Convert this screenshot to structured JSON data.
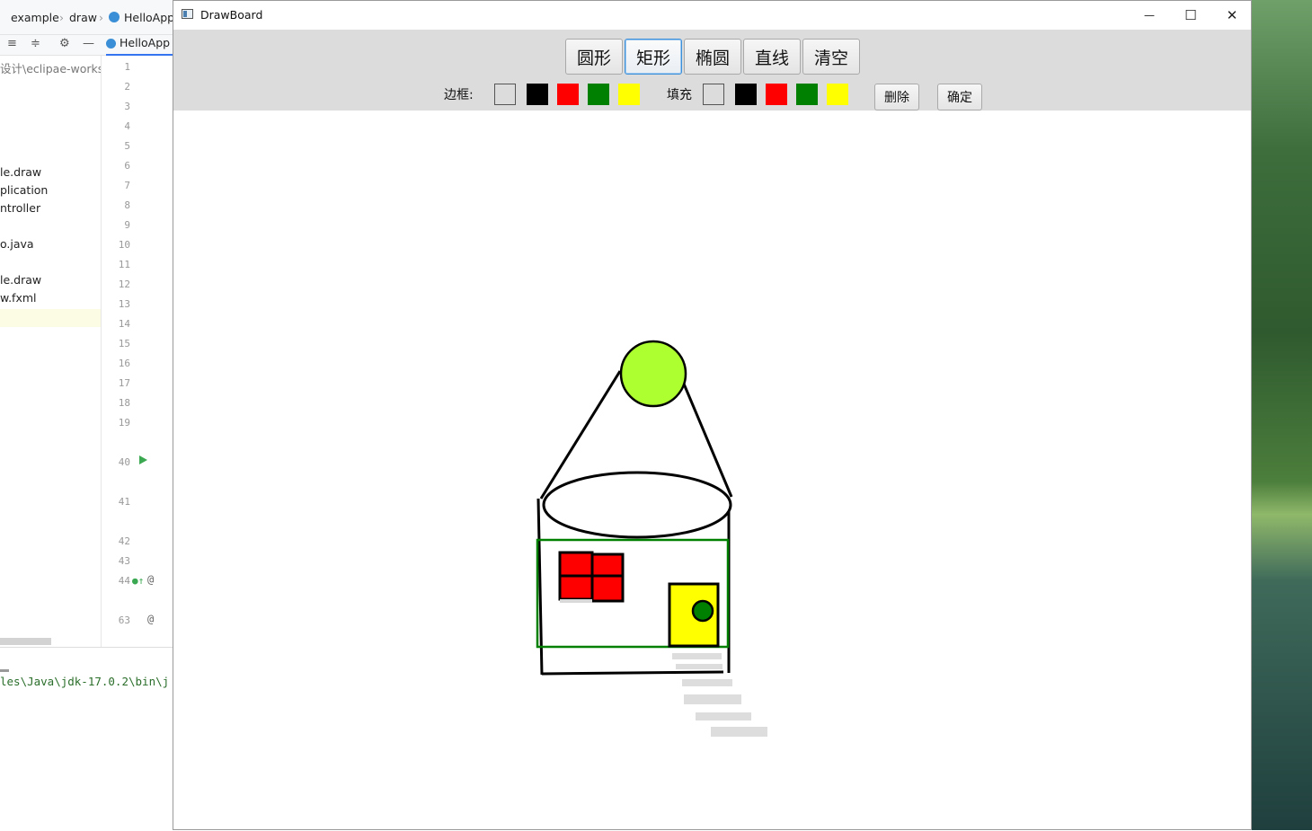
{
  "ide": {
    "breadcrumbs": [
      "example",
      "draw",
      "HelloApp"
    ],
    "editor_tab": "HelloApp",
    "tree_items": [
      "设计\\eclipae-works",
      "le.draw",
      "plication",
      "ntroller",
      "o.java",
      "le.draw",
      "w.fxml"
    ],
    "line_numbers": [
      "1",
      "2",
      "3",
      "4",
      "5",
      "6",
      "7",
      "8",
      "9",
      "10",
      "11",
      "12",
      "13",
      "14",
      "15",
      "16",
      "17",
      "18",
      "19",
      "40",
      "41",
      "42",
      "43",
      "44",
      "63"
    ],
    "console_text": "les\\Java\\jdk-17.0.2\\bin\\j"
  },
  "window": {
    "title": "DrawBoard",
    "controls": {
      "minimize": "—",
      "maximize": "☐",
      "close": "✕"
    }
  },
  "toolbar": {
    "shapes": [
      "圆形",
      "矩形",
      "椭圆",
      "直线",
      "清空"
    ],
    "active_shape": "矩形",
    "border_label": "边框:",
    "fill_label": "填充",
    "border_colors": [
      "none",
      "#000000",
      "#ff0000",
      "#008000",
      "#ffff00"
    ],
    "fill_colors": [
      "none",
      "#000000",
      "#ff0000",
      "#008000",
      "#ffff00"
    ],
    "delete_label": "删除",
    "confirm_label": "确定"
  },
  "drawing": {
    "sun_fill": "#adff2f",
    "roof_line_color": "#000000",
    "house_border_color": "#008000",
    "window_fill": "#ff0000",
    "door_fill": "#ffff00",
    "knob_fill": "#008000"
  }
}
